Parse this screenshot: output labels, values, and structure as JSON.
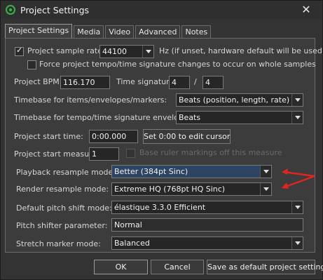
{
  "window": {
    "title": "Project Settings",
    "close_glyph": "✕"
  },
  "tabs": [
    "Project Settings",
    "Media",
    "Video",
    "Advanced",
    "Notes"
  ],
  "sample_rate": {
    "label": "Project sample rate:",
    "checked": true,
    "value": "44100",
    "hint": "Hz (if unset, hardware default will be used)"
  },
  "force_tempo": {
    "label": "Force project tempo/time signature changes to occur on whole samples",
    "checked": false
  },
  "bpm": {
    "label": "Project BPM:",
    "value": "116.170"
  },
  "time_signature": {
    "label": "Time signature",
    "numerator": "4",
    "separator": "/",
    "denominator": "4"
  },
  "timebase_items": {
    "label": "Timebase for items/envelopes/markers:",
    "value": "Beats (position, length, rate)"
  },
  "timebase_tempo": {
    "label": "Timebase for tempo/time signature envelope:",
    "value": "Beats"
  },
  "start_time": {
    "label": "Project start time:",
    "value": "0:00.000",
    "button": "Set 0:00 to edit cursor"
  },
  "start_measure": {
    "label": "Project start measure:",
    "value": "1",
    "base_ruler_label": "Base ruler markings off this measure",
    "base_ruler_checked": false
  },
  "playback_resample": {
    "label": "Playback resample mode:",
    "value": "Better (384pt Sinc)"
  },
  "render_resample": {
    "label": "Render resample mode:",
    "value": "Extreme HQ (768pt HQ Sinc)"
  },
  "pitch_shift": {
    "label": "Default pitch shift mode:",
    "value": "élastique 3.3.0 Efficient"
  },
  "pitch_param": {
    "label": "Pitch shifter parameter:",
    "value": "Normal"
  },
  "stretch_marker": {
    "label": "Stretch marker mode:",
    "value": "Balanced"
  },
  "buttons": {
    "ok": "OK",
    "cancel": "Cancel",
    "save_default": "Save as default project settings"
  },
  "colors": {
    "annotation_arrow": "#e0241f",
    "highlight": "#2d4562",
    "app_icon": "#35b24a"
  },
  "icons": {
    "app": "reaper-app-icon",
    "close": "close-icon",
    "dropdown": "chevron-down-icon"
  }
}
